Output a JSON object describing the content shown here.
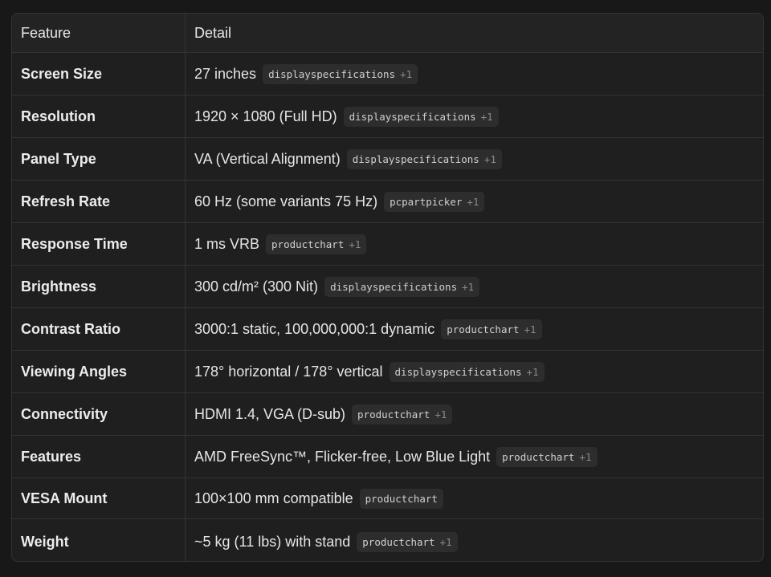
{
  "table": {
    "headers": {
      "feature": "Feature",
      "detail": "Detail"
    },
    "rows": [
      {
        "feature": "Screen Size",
        "detail": "27 inches",
        "source": "displayspecifications",
        "extra": "+1"
      },
      {
        "feature": "Resolution",
        "detail": "1920 × 1080 (Full HD)",
        "source": "displayspecifications",
        "extra": "+1"
      },
      {
        "feature": "Panel Type",
        "detail": "VA (Vertical Alignment)",
        "source": "displayspecifications",
        "extra": "+1"
      },
      {
        "feature": "Refresh Rate",
        "detail": "60 Hz (some variants 75 Hz)",
        "source": "pcpartpicker",
        "extra": "+1"
      },
      {
        "feature": "Response Time",
        "detail": "1 ms VRB",
        "source": "productchart",
        "extra": "+1"
      },
      {
        "feature": "Brightness",
        "detail": "300 cd/m² (300 Nit)",
        "source": "displayspecifications",
        "extra": "+1"
      },
      {
        "feature": "Contrast Ratio",
        "detail": "3000:1 static, 100,000,000:1 dynamic",
        "source": "productchart",
        "extra": "+1"
      },
      {
        "feature": "Viewing Angles",
        "detail": "178° horizontal / 178° vertical",
        "source": "displayspecifications",
        "extra": "+1"
      },
      {
        "feature": "Connectivity",
        "detail": "HDMI 1.4, VGA (D-sub)",
        "source": "productchart",
        "extra": "+1"
      },
      {
        "feature": "Features",
        "detail": "AMD FreeSync™, Flicker-free, Low Blue Light",
        "source": "productchart",
        "extra": "+1"
      },
      {
        "feature": "VESA Mount",
        "detail": "100×100 mm compatible",
        "source": "productchart",
        "extra": ""
      },
      {
        "feature": "Weight",
        "detail": "~5 kg (11 lbs) with stand",
        "source": "productchart",
        "extra": "+1"
      }
    ]
  }
}
